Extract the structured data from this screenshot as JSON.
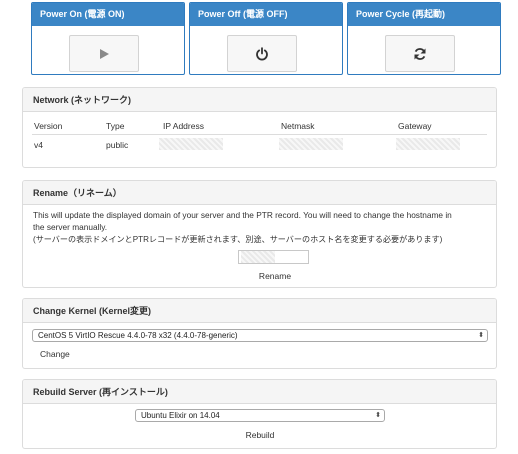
{
  "power": {
    "on_title": "Power On (電源 ON)",
    "off_title": "Power Off (電源 OFF)",
    "cycle_title": "Power Cycle (再起動)"
  },
  "network": {
    "title": "Network (ネットワーク)",
    "columns": [
      "Version",
      "Type",
      "IP Address",
      "Netmask",
      "Gateway"
    ],
    "row": {
      "version": "v4",
      "type": "public"
    }
  },
  "rename": {
    "title": "Rename（リネーム）",
    "desc_line1": "This will update the displayed domain of your server and the PTR record. You will need to change the hostname in",
    "desc_line2": "the server manually.",
    "desc_line3": "(サーバーの表示ドメインとPTRレコードが更新されます、別途、サーバーのホスト名を変更する必要があります)",
    "button_label": "Rename"
  },
  "kernel": {
    "title": "Change Kernel (Kernel変更)",
    "selected": "CentOS 5 VirtIO Rescue 4.4.0-78 x32 (4.4.0-78-generic)",
    "button_label": "Change"
  },
  "rebuild": {
    "title": "Rebuild Server (再インストール)",
    "selected": "Ubuntu Elixir on 14.04",
    "button_label": "Rebuild"
  },
  "colors": {
    "accent": "#3b86c6",
    "panel_header": "#f5f5f5",
    "border": "#dcdcdc"
  }
}
